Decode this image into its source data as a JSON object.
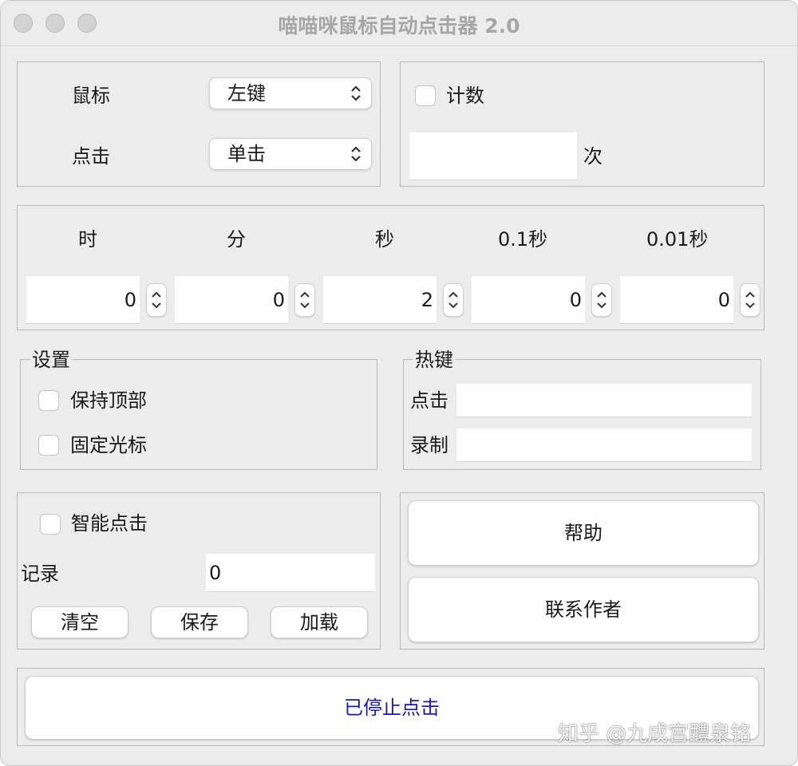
{
  "window": {
    "title": "喵喵咪鼠标自动点击器 2.0"
  },
  "mouse_panel": {
    "mouse_label": "鼠标",
    "mouse_value": "左键",
    "click_label": "点击",
    "click_value": "单击"
  },
  "count_panel": {
    "checkbox_label": "计数",
    "count_value": "",
    "unit": "次"
  },
  "interval_panel": {
    "headers": [
      "时",
      "分",
      "秒",
      "0.1秒",
      "0.01秒"
    ],
    "values": [
      "0",
      "0",
      "2",
      "0",
      "0"
    ]
  },
  "settings": {
    "title": "设置",
    "keep_on_top": "保持顶部",
    "fix_cursor": "固定光标"
  },
  "hotkeys": {
    "title": "热键",
    "click_label": "点击",
    "click_value": "",
    "record_label": "录制",
    "record_value": ""
  },
  "smart": {
    "checkbox_label": "智能点击",
    "record_label": "记录",
    "record_value": "0",
    "clear": "清空",
    "save": "保存",
    "load": "加载"
  },
  "actions": {
    "help": "帮助",
    "contact": "联系作者",
    "status": "已停止点击"
  },
  "colors": {
    "status_text": "#1a1aa8"
  },
  "watermark": "知乎 @九成宫醴泉铭"
}
